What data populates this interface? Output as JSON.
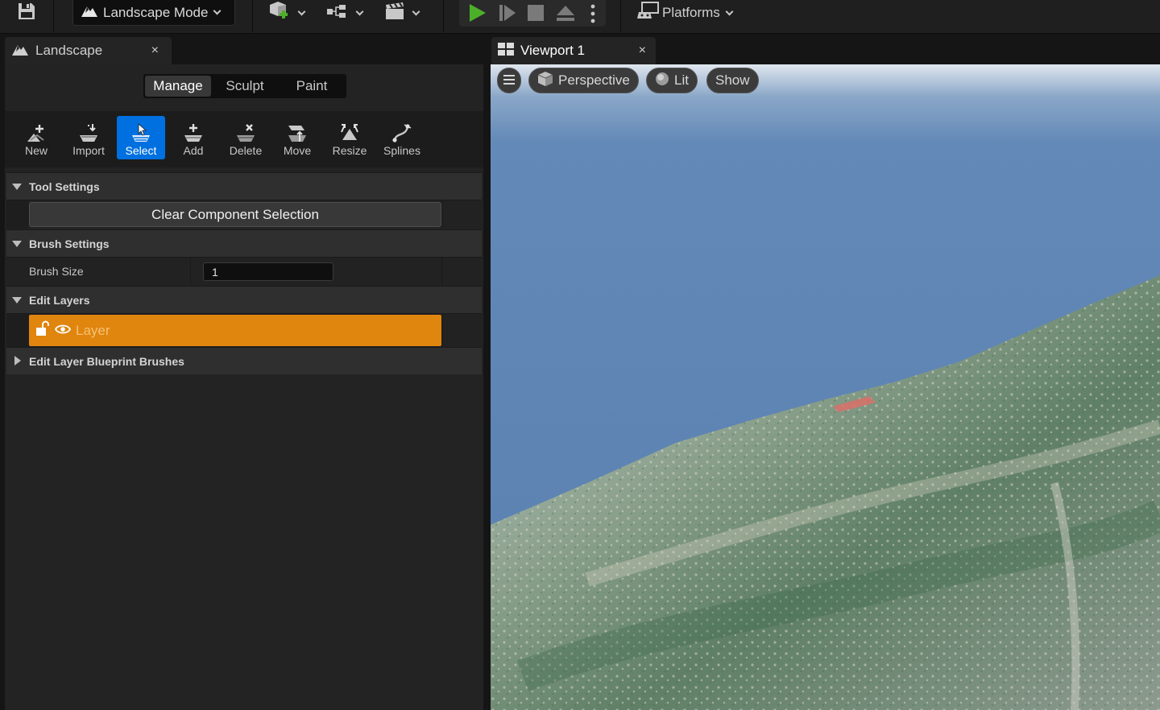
{
  "toolbar": {
    "mode_label": "Landscape Mode",
    "platforms_label": "Platforms",
    "colors": {
      "play": "#4caf2a",
      "accent": "#0070e0"
    }
  },
  "left_panel": {
    "tab_title": "Landscape",
    "close_glyph": "×",
    "modes": [
      "Manage",
      "Sculpt",
      "Paint"
    ],
    "active_mode": "Manage",
    "tools": [
      {
        "label": "New",
        "icon": "new-landscape-icon"
      },
      {
        "label": "Import",
        "icon": "import-icon"
      },
      {
        "label": "Select",
        "icon": "select-icon"
      },
      {
        "label": "Add",
        "icon": "add-component-icon"
      },
      {
        "label": "Delete",
        "icon": "delete-component-icon"
      },
      {
        "label": "Move",
        "icon": "move-icon"
      },
      {
        "label": "Resize",
        "icon": "resize-icon"
      },
      {
        "label": "Splines",
        "icon": "splines-icon"
      }
    ],
    "active_tool": "Select",
    "tool_settings": {
      "header": "Tool Settings",
      "clear_button": "Clear Component Selection"
    },
    "brush_settings": {
      "header": "Brush Settings",
      "brush_size_label": "Brush Size",
      "brush_size_value": "1"
    },
    "edit_layers": {
      "header": "Edit Layers",
      "layer_name": "Layer",
      "layer_color": "#e0850e"
    },
    "blueprint_brushes": {
      "header": "Edit Layer Blueprint Brushes"
    }
  },
  "viewport": {
    "tab_title": "Viewport 1",
    "close_glyph": "×",
    "perspective_label": "Perspective",
    "lit_label": "Lit",
    "show_label": "Show"
  }
}
